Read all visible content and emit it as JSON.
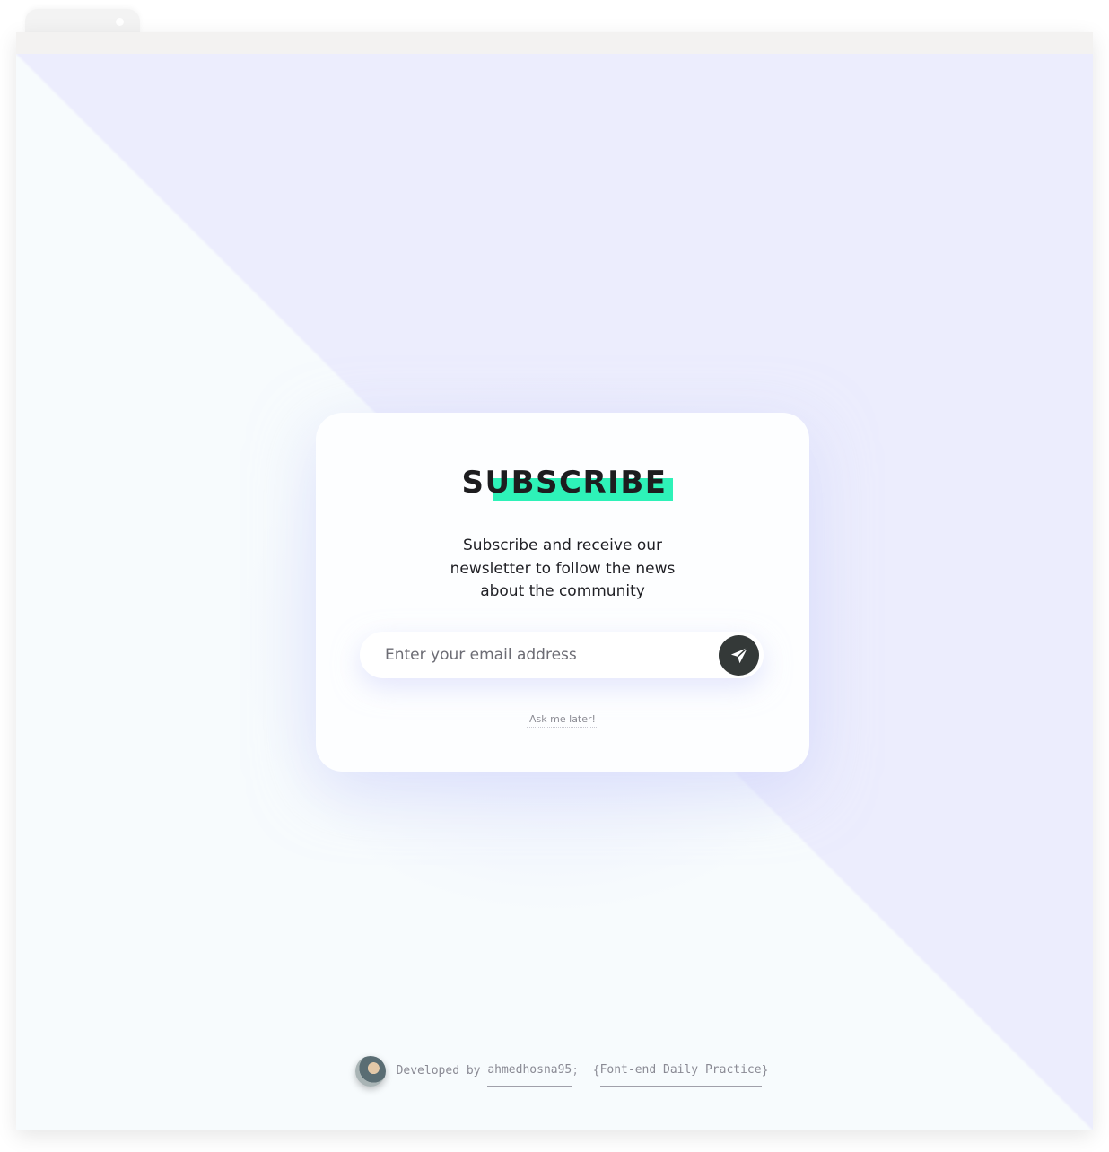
{
  "card": {
    "title": "SUBSCRIBE",
    "description": "Subscribe and receive our newsletter to follow the news about the community",
    "email_placeholder": "Enter your email address",
    "send_icon": "paper-plane-icon",
    "ask_later_label": "Ask me later!"
  },
  "footer": {
    "developed_by_label": "Developed by",
    "author_link": "ahmedhosna95",
    "separator": ";",
    "brace_open": "{",
    "project_link": "Font-end Daily Practice",
    "brace_close": "}"
  },
  "colors": {
    "accent_highlight": "#2ef2b8",
    "send_button": "#343938",
    "background_light": "#f7fbfd",
    "background_lavender": "#ecedfd"
  }
}
